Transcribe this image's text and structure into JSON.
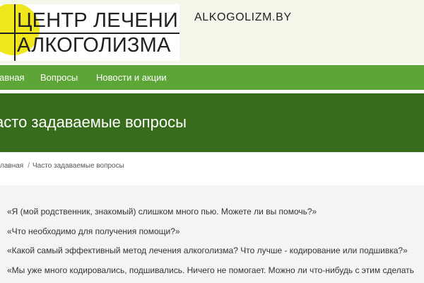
{
  "header": {
    "logo_line1": "ЦЕНТР ЛЕЧЕНИЯ",
    "logo_line2": "АЛКОГОЛИЗМА",
    "domain": "ALKOGOLIZM.BY"
  },
  "nav": {
    "items": [
      {
        "label": "авная"
      },
      {
        "label": "Вопросы"
      },
      {
        "label": "Новости и акции"
      }
    ]
  },
  "hero": {
    "title": "асто задаваемые вопросы"
  },
  "breadcrumb": {
    "home": "лавная",
    "separator": "/",
    "current": "Часто задаваемые вопросы"
  },
  "faq": {
    "items": [
      {
        "text": "«Я (мой родственник, знакомый) слишком много пью. Можете ли вы помочь?»"
      },
      {
        "text": "«Что необходимо для получения помощи?»"
      },
      {
        "text": "«Какой самый эффективный метод лечения алкоголизма? Что лучше - кодирование или подшивка?»"
      },
      {
        "text": "«Мы уже много кодировались, подшивались. Ничего не помогает. Можно ли что-нибудь с этим сделать"
      }
    ]
  },
  "colors": {
    "nav_bg": "#5ea538",
    "hero_bg": "#386c1d",
    "header_bg": "#f2f7ea",
    "logo_accent": "#f0e61c"
  }
}
